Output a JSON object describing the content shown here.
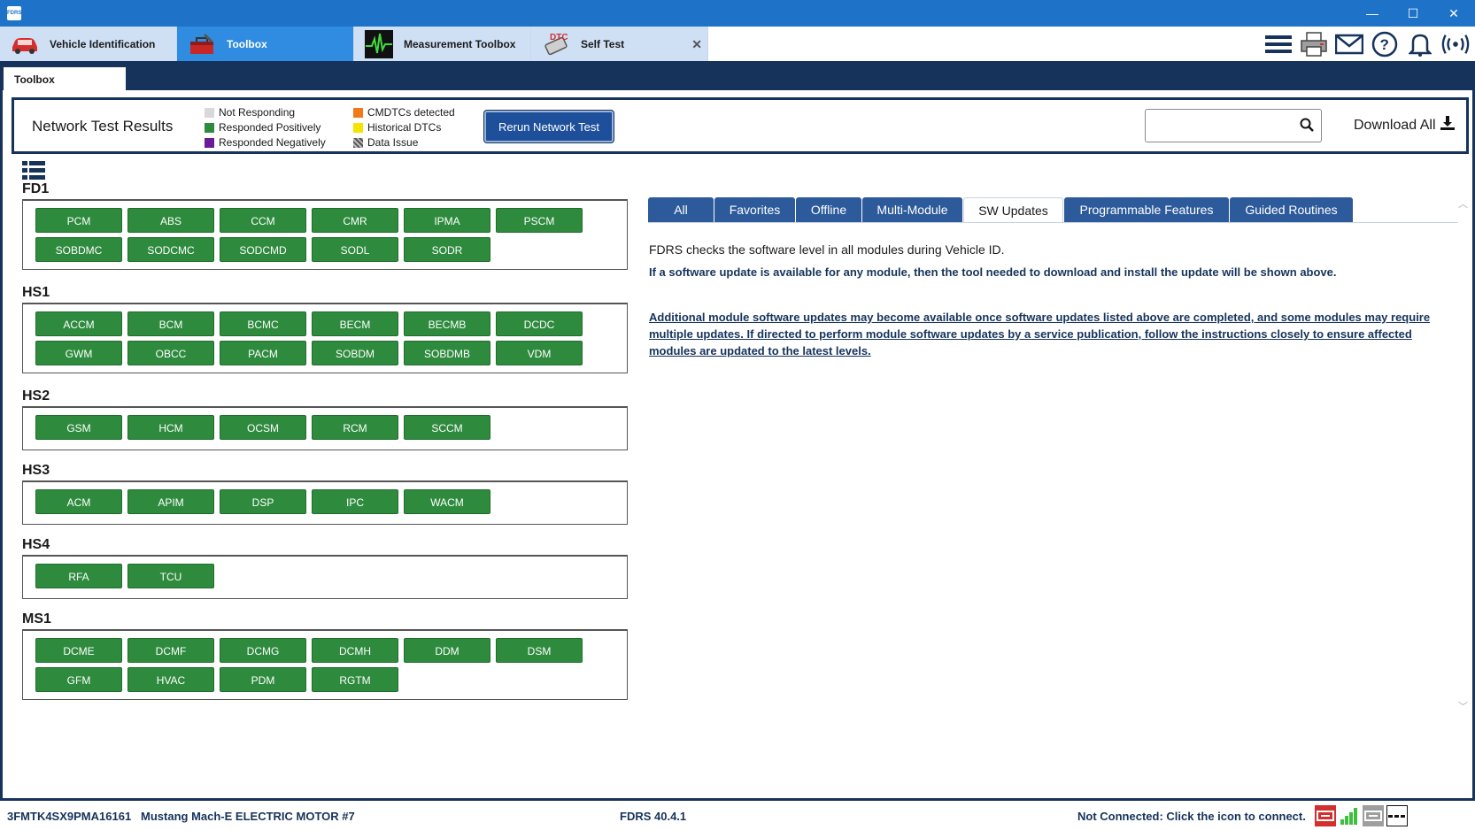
{
  "window": {
    "logo_text": "FDRS",
    "controls": {
      "minimize": "—",
      "maximize": "☐",
      "close": "✕"
    }
  },
  "top_tabs": [
    {
      "label": "Vehicle Identification",
      "icon": "car-icon"
    },
    {
      "label": "Toolbox",
      "icon": "toolbox-icon"
    },
    {
      "label": "Measurement Toolbox",
      "icon": "waveform-icon"
    },
    {
      "label": "Self Test",
      "icon": "dtc-icon",
      "badge": "DTC"
    }
  ],
  "toolbar_icons": [
    "menu-icon",
    "printer-icon",
    "mail-icon",
    "help-icon",
    "bell-icon",
    "broadcast-icon"
  ],
  "sub_tab": {
    "label": "Toolbox"
  },
  "network": {
    "title": "Network Test Results",
    "legend": [
      {
        "label": "Not Responding",
        "color": "#d9d9d9"
      },
      {
        "label": "Responded Positively",
        "color": "#2e8b3e"
      },
      {
        "label": "Responded Negatively",
        "color": "#6a1b9a"
      },
      {
        "label": "CMDTCs detected",
        "color": "#f07a1a"
      },
      {
        "label": "Historical DTCs",
        "color": "#f5e400"
      },
      {
        "label": "Data Issue",
        "color": "#777777"
      }
    ],
    "rerun_label": "Rerun Network Test",
    "search_placeholder": "",
    "download_label": "Download All"
  },
  "groups": [
    {
      "name": "FD1",
      "modules": [
        "PCM",
        "ABS",
        "CCM",
        "CMR",
        "IPMA",
        "PSCM",
        "SOBDMC",
        "SODCMC",
        "SODCMD",
        "SODL",
        "SODR"
      ]
    },
    {
      "name": "HS1",
      "modules": [
        "ACCM",
        "BCM",
        "BCMC",
        "BECM",
        "BECMB",
        "DCDC",
        "GWM",
        "OBCC",
        "PACM",
        "SOBDM",
        "SOBDMB",
        "VDM"
      ]
    },
    {
      "name": "HS2",
      "modules": [
        "GSM",
        "HCM",
        "OCSM",
        "RCM",
        "SCCM"
      ]
    },
    {
      "name": "HS3",
      "modules": [
        "ACM",
        "APIM",
        "DSP",
        "IPC",
        "WACM"
      ]
    },
    {
      "name": "HS4",
      "modules": [
        "RFA",
        "TCU"
      ]
    },
    {
      "name": "MS1",
      "modules": [
        "DCME",
        "DCMF",
        "DCMG",
        "DCMH",
        "DDM",
        "DSM",
        "GFM",
        "HVAC",
        "PDM",
        "RGTM"
      ]
    }
  ],
  "right_tabs": [
    {
      "label": "All"
    },
    {
      "label": "Favorites"
    },
    {
      "label": "Offline"
    },
    {
      "label": "Multi-Module"
    },
    {
      "label": "SW Updates",
      "active": true
    },
    {
      "label": "Programmable Features"
    },
    {
      "label": "Guided Routines"
    }
  ],
  "sw_updates": {
    "line1": "FDRS checks the software level in all modules during Vehicle ID.",
    "line2": "If a software update is available for any module, then the tool needed to download and install the update will be shown above.",
    "line3": "Additional module software updates may become available once software updates listed above are completed, and some modules may require multiple updates. If directed to perform module software updates by a service publication, follow the instructions closely to ensure affected modules are updated to the latest levels."
  },
  "status": {
    "vin": "3FMTK4SX9PMA16161",
    "vehicle": "Mustang Mach-E ELECTRIC MOTOR #7",
    "version": "FDRS 40.4.1",
    "connection": "Not Connected: Click the icon to connect.",
    "icons": [
      "vci-red-icon",
      "signal-bars-icon",
      "vci-gray-icon",
      "dashes-icon"
    ]
  }
}
